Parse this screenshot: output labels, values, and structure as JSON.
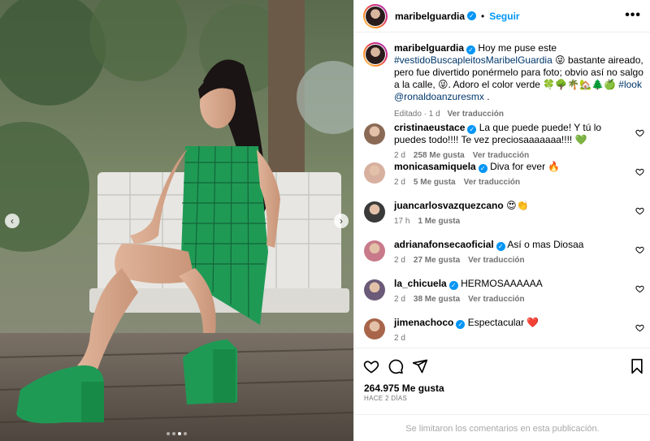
{
  "post": {
    "username": "maribelguardia",
    "follow_label": "Seguir",
    "separator": "•",
    "more_label": "•••",
    "nav_prev": "‹",
    "nav_next": "›"
  },
  "caption": {
    "username": "maribelguardia",
    "text_1": "Hoy me puse este",
    "hashtag_1": "#vestidoBuscapleitosMaribelGuardia",
    "text_2": "😜 bastante aireado, pero fue divertido ponérmelo para foto; obvio así no salgo a la calle, 😜. Adoro el color verde 🍀🌳🌴🏡🌲🍏",
    "hashtag_2": "#look",
    "mention": "@ronaldoanzuresmx",
    "text_3": ".",
    "edited": "Editado · 1 d",
    "see_translation": "Ver traducción"
  },
  "comments": [
    {
      "username": "cristinaeustace",
      "verified": true,
      "text": "La que puede puede! Y tú lo puedes todo!!!! Te vez preciosaaaaaaa!!!! 💚",
      "time": "2 d",
      "likes": "258 Me gusta",
      "translate": "Ver traducción",
      "avatar_color": "#8a6a55"
    },
    {
      "username": "monicasamiquela",
      "verified": true,
      "text": "Diva for ever 🔥",
      "time": "2 d",
      "likes": "5 Me gusta",
      "translate": "Ver traducción",
      "avatar_color": "#d8b0a0"
    },
    {
      "username": "juancarlosvazquezcano",
      "verified": false,
      "text": "😍👏",
      "time": "17 h",
      "likes": "1 Me gusta",
      "translate": "",
      "avatar_color": "#3a3a3a"
    },
    {
      "username": "adrianafonsecaoficial",
      "verified": true,
      "text": "Así o mas Diosaa",
      "time": "2 d",
      "likes": "27 Me gusta",
      "translate": "Ver traducción",
      "avatar_color": "#c87a8a"
    },
    {
      "username": "la_chicuela",
      "verified": true,
      "text": "HERMOSAAAAAA",
      "time": "2 d",
      "likes": "38 Me gusta",
      "translate": "Ver traducción",
      "avatar_color": "#6b5a78"
    },
    {
      "username": "jimenachoco",
      "verified": true,
      "text": "Espectacular ❤️",
      "time": "2 d",
      "likes": "",
      "translate": "",
      "avatar_color": "#a8654a"
    }
  ],
  "footer": {
    "likes_count": "264.975 Me gusta",
    "posted": "HACE 2 DÍAS",
    "comments_limited": "Se limitaron los comentarios en esta publicación."
  },
  "carousel": {
    "slide_count": 4,
    "active_slide": 3
  },
  "colors": {
    "accent": "#0095f6",
    "link": "#00376b",
    "muted": "#737373",
    "dress_green": "#1f9a55"
  }
}
